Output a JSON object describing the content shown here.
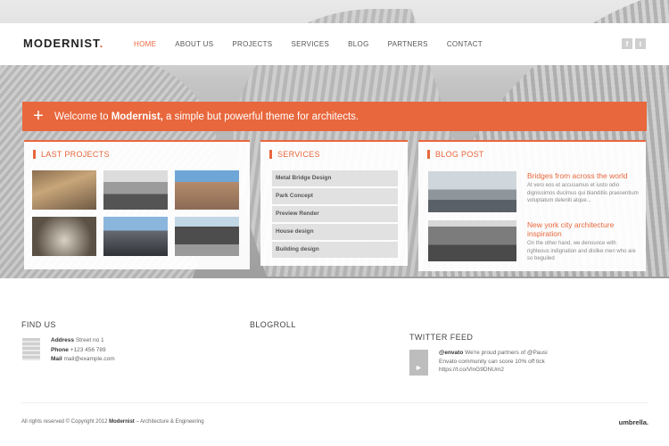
{
  "header": {
    "logo": "MODERNIST",
    "logo_dot": ".",
    "nav": [
      "HOME",
      "ABOUT US",
      "PROJECTS",
      "SERVICES",
      "BLOG",
      "PARTNERS",
      "CONTACT"
    ],
    "social": [
      "f",
      "t"
    ]
  },
  "banner": {
    "plus": "+",
    "before": "Welcome to ",
    "brand": "Modernist,",
    "after": " a simple but powerful theme for architects."
  },
  "projects": {
    "title": "LAST PROJECTS"
  },
  "services": {
    "title": "SERVICES",
    "items": [
      "Metal Bridge Design",
      "Park Concept",
      "Preview Render",
      "House design",
      "Building design"
    ]
  },
  "blog": {
    "title": "BLOG POST",
    "posts": [
      {
        "title": "Bridges from across the world",
        "text": "At vero eos et accusamus et iusto odio dignissimos ducimus qui blanditiis praesentium voluptatum deleniti atque..."
      },
      {
        "title": "New york city architecture inspiration",
        "text": "On the other hand, we denounce with righteous indignation and dislike men who are so beguiled"
      }
    ]
  },
  "footer": {
    "find_us": "FIND US",
    "blogroll": "BLOGROLL",
    "twitter_feed": "TWITTER FEED",
    "address_label": "Address",
    "address": "Street no 1",
    "phone_label": "Phone",
    "phone": "+123 456 789",
    "mail_label": "Mail",
    "mail": "mail@example.com",
    "tweet_user": "@envato",
    "tweet_text": "We're proud partners of @Pausi Envato community can score 10% off tick https://t.co/VlnG9DNUm2",
    "copyright_pre": "All rights reserved © Copyright 2012 ",
    "copyright_brand": "Modernist",
    "copyright_post": " – Architecture & Engineering",
    "brand": "umbrella."
  },
  "colors": {
    "accent": "#e8673c"
  }
}
